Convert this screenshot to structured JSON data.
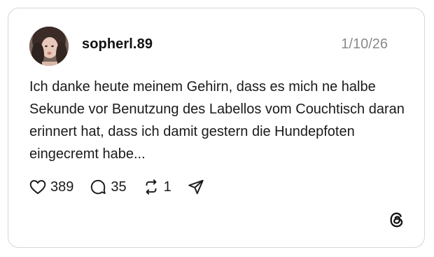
{
  "post": {
    "username": "sopherl.89",
    "date": "1/10/26",
    "text": "Ich danke heute meinem Gehirn, dass es mich ne halbe Sekunde vor Benutzung des Labellos vom Couchtisch daran erinnert hat, dass ich damit gestern die Hundepfoten eingecremt habe..."
  },
  "actions": {
    "likes": "389",
    "replies": "35",
    "reposts": "1"
  },
  "icons": {
    "like": "heart-icon",
    "reply": "speech-bubble-icon",
    "repost": "repost-icon",
    "share": "send-icon",
    "brand": "threads-logo-icon"
  },
  "colors": {
    "text": "#1a1a1a",
    "muted": "#8a8a8a",
    "border": "#d6d6d6"
  }
}
